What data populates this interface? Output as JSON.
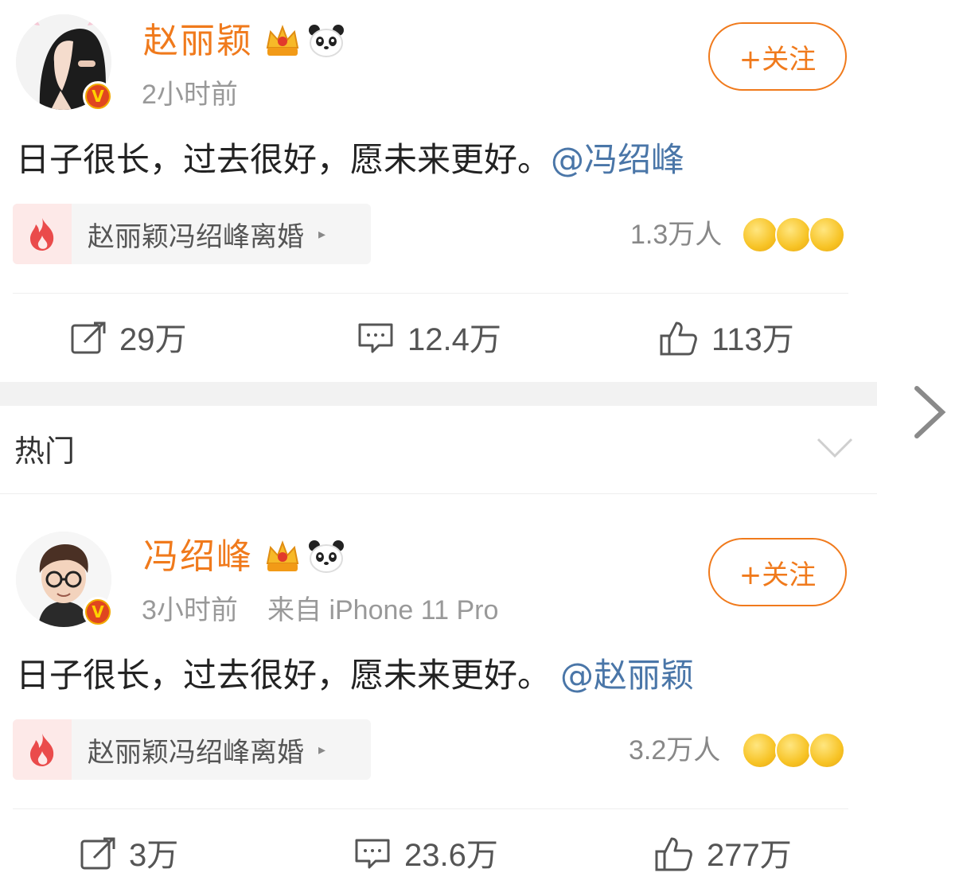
{
  "posts": [
    {
      "username": "赵丽颖",
      "time": "2小时前",
      "source": "",
      "follow_label": "+关注",
      "text": "日子很长，过去很好，愿未来更好。",
      "mention": "@冯绍峰",
      "topic": "赵丽颖冯绍峰离婚",
      "topic_count": "1.3万人",
      "repost": "29万",
      "comment": "12.4万",
      "like": "113万"
    },
    {
      "username": "冯绍峰",
      "time": "3小时前",
      "source": "来自 iPhone 11 Pro",
      "follow_label": "+关注",
      "text": "日子很长，过去很好，愿未来更好。",
      "mention": "@赵丽颖",
      "topic": "赵丽颖冯绍峰离婚",
      "topic_count": "3.2万人",
      "repost": "3万",
      "comment": "23.6万",
      "like": "277万"
    }
  ],
  "section": {
    "hot_label": "热门"
  },
  "icons": {
    "verify": "verified-v-icon",
    "crown": "crown-icon",
    "panda": "panda-icon",
    "fire": "fire-icon",
    "repost": "repost-icon",
    "comment": "comment-icon",
    "like": "thumbs-up-icon",
    "chevron_right": "chevron-right-icon",
    "chevron_down": "chevron-down-icon"
  },
  "colors": {
    "username": "#f07a1c",
    "mention": "#4a76a8",
    "follow": "#f07a1c",
    "verify_outer": "#f2a900",
    "verify_inner": "#e0461f",
    "fire": "#ea4b4b"
  }
}
